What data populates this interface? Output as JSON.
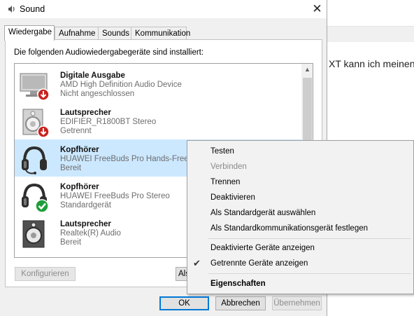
{
  "background": {
    "text": "XT kann ich meinen"
  },
  "window": {
    "title": "Sound",
    "close_glyph": "✕"
  },
  "tabs": [
    {
      "label": "Wiedergabe"
    },
    {
      "label": "Aufnahme"
    },
    {
      "label": "Sounds"
    },
    {
      "label": "Kommunikation"
    }
  ],
  "panel": {
    "label": "Die folgenden Audiowiedergabegeräte sind installiert:"
  },
  "devices": [
    {
      "name": "Digitale Ausgabe",
      "description": "AMD High Definition Audio Device",
      "status": "Nicht angeschlossen",
      "icon": "monitor-icon",
      "badge": "red-down-arrow"
    },
    {
      "name": "Lautsprecher",
      "description": "EDIFIER_R1800BT Stereo",
      "status": "Getrennt",
      "icon": "speaker-icon",
      "badge": "red-down-arrow"
    },
    {
      "name": "Kopfhörer",
      "description": "HUAWEI FreeBuds Pro Hands-Free AG Audio",
      "status": "Bereit",
      "icon": "headset-icon",
      "badge": "none"
    },
    {
      "name": "Kopfhörer",
      "description": "HUAWEI FreeBuds Pro Stereo",
      "status": "Standardgerät",
      "icon": "headphones-icon",
      "badge": "green-check"
    },
    {
      "name": "Lautsprecher",
      "description": "Realtek(R) Audio",
      "status": "Bereit",
      "icon": "speaker-icon",
      "badge": "none"
    }
  ],
  "buttons": {
    "configure": "Konfigurieren",
    "set_default": "Als Standard",
    "ok": "OK",
    "cancel": "Abbrechen",
    "apply": "Übernehmen"
  },
  "context_menu": {
    "items": [
      {
        "label": "Testen",
        "disabled": false
      },
      {
        "label": "Verbinden",
        "disabled": true
      },
      {
        "label": "Trennen",
        "disabled": false
      },
      {
        "label": "Deaktivieren",
        "disabled": false
      },
      {
        "label": "Als Standardgerät auswählen",
        "disabled": false
      },
      {
        "label": "Als Standardkommunikationsgerät festlegen",
        "disabled": false
      },
      {
        "label": "Deaktivierte Geräte anzeigen",
        "highlighted": true,
        "highlight_color": "#f8f800"
      },
      {
        "label": "Getrennte Geräte anzeigen",
        "checked": true
      },
      {
        "label": "Eigenschaften",
        "bold": true
      }
    ]
  },
  "colors": {
    "selection": "#cce8ff",
    "highlight": "#f8f800",
    "default_button_border": "#0078d7",
    "status_ok": "#1e9e3a",
    "status_disconnected": "#d42020"
  }
}
